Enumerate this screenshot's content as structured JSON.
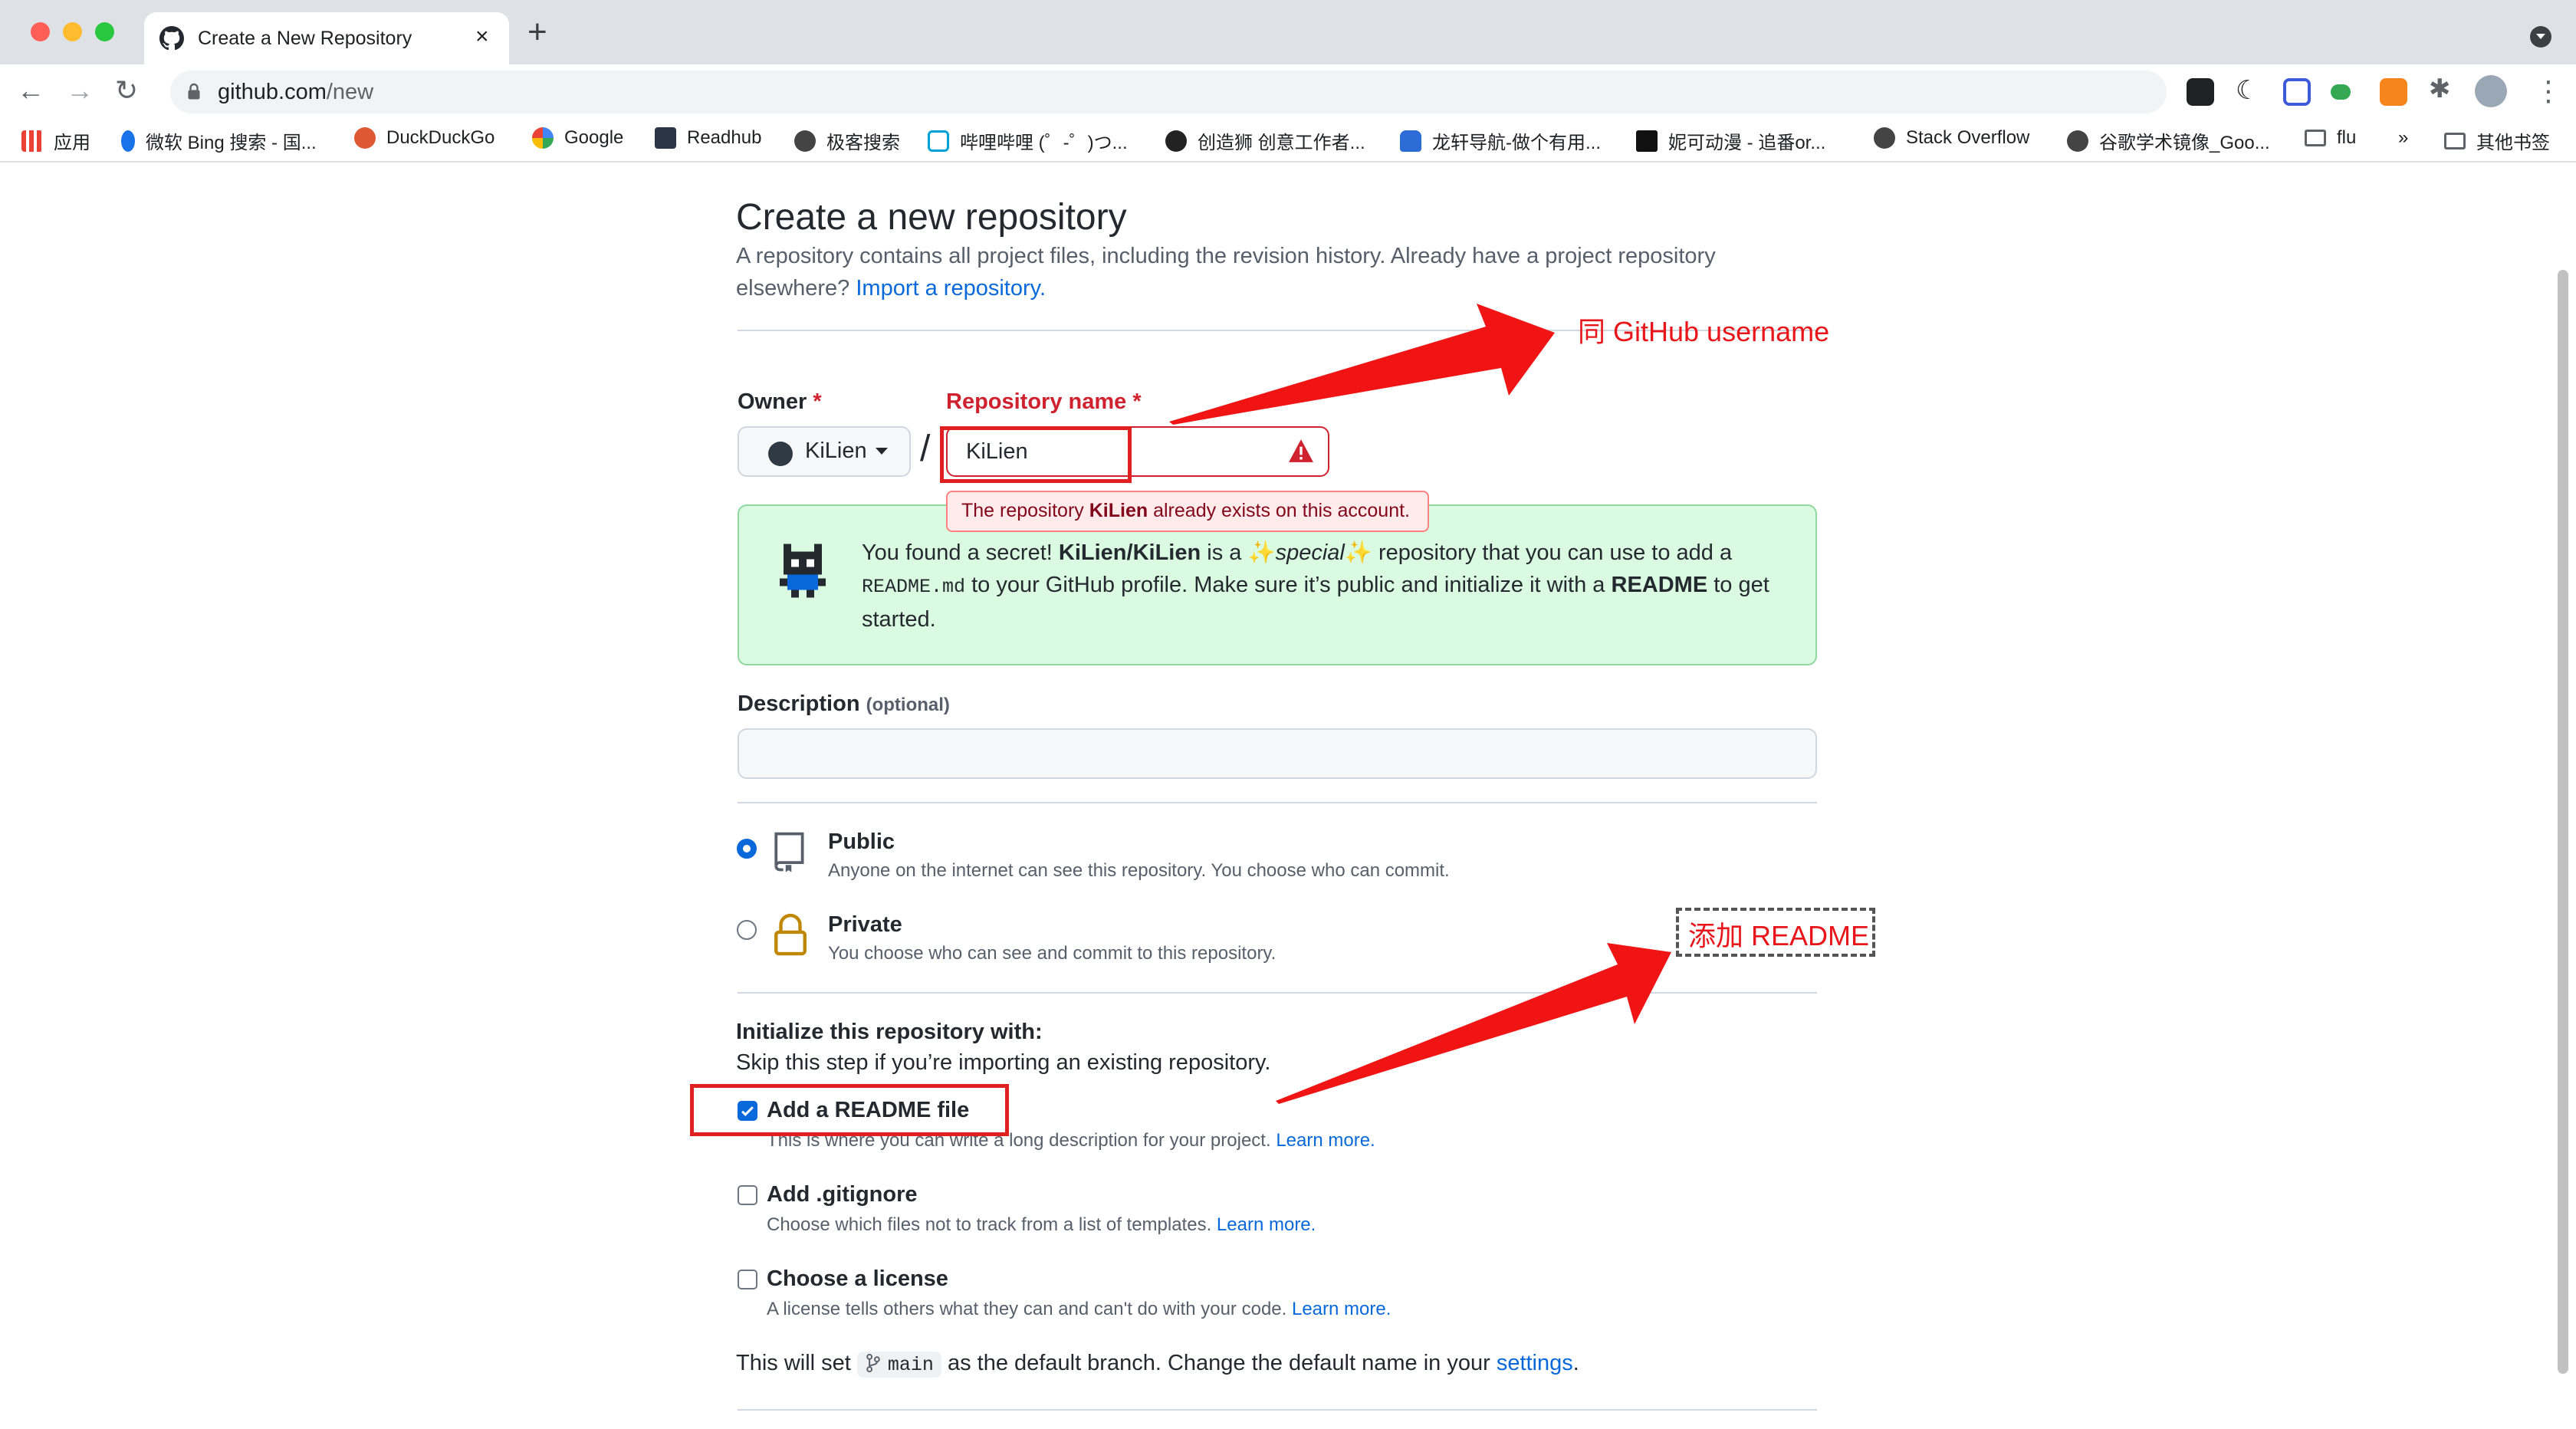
{
  "browser": {
    "tab_title": "Create a New Repository",
    "tab_close": "×",
    "new_tab": "+",
    "url_host": "github.com",
    "url_path": "/new",
    "bookmarks": [
      {
        "label": "应用",
        "color": "#4285f4"
      },
      {
        "label": "微软 Bing 搜索 - 国...",
        "color": "#1a73e8"
      },
      {
        "label": "DuckDuckGo",
        "color": "#de5833"
      },
      {
        "label": "Google",
        "color": "#4285f4"
      },
      {
        "label": "Readhub",
        "color": "#2b3445"
      },
      {
        "label": "极客搜索",
        "color": "#444444"
      },
      {
        "label": "哔哩哔哩 (゜-゜)つ...",
        "color": "#00a1d6"
      },
      {
        "label": "创造狮 创意工作者...",
        "color": "#222222"
      },
      {
        "label": "龙轩导航-做个有用...",
        "color": "#2d6bd6"
      },
      {
        "label": "妮可动漫 - 追番or...",
        "color": "#111111"
      },
      {
        "label": "Stack Overflow",
        "color": "#444444"
      },
      {
        "label": "谷歌学术镜像_Goo...",
        "color": "#444444"
      },
      {
        "label": "flu",
        "color": "#5f6368"
      },
      {
        "label": "»",
        "color": "#5f6368"
      },
      {
        "label": "其他书签",
        "color": "#5f6368"
      }
    ]
  },
  "page": {
    "title": "Create a new repository",
    "intro_line1": "A repository contains all project files, including the revision history. Already have a project repository",
    "intro_line2_prefix": "elsewhere? ",
    "import_link": "Import a repository.",
    "owner_label": "Owner",
    "required_mark": "*",
    "repo_label": "Repository name",
    "owner_value": "KiLien",
    "slash": "/",
    "repo_value": "KiLien",
    "error_prefix": "The repository ",
    "error_name": "KiLien",
    "error_suffix": " already exists on this account.",
    "secret_part1": "You found a secret! ",
    "secret_repo": "KiLien/KiLien",
    "secret_part2": " is a ✨",
    "secret_special": "special",
    "secret_part3": "✨ repository that you can use to add a ",
    "secret_code": "README.md",
    "secret_part4": " to your GitHub profile. Make sure it’s public and initialize it with a ",
    "secret_readme": "README",
    "secret_part5": " to get started.",
    "description_label": "Description",
    "description_optional": "(optional)",
    "public_title": "Public",
    "public_desc": "Anyone on the internet can see this repository. You choose who can commit.",
    "private_title": "Private",
    "private_desc": "You choose who can see and commit to this repository.",
    "init_title": "Initialize this repository with:",
    "init_sub": "Skip this step if you’re importing an existing repository.",
    "readme_title": "Add a README file",
    "readme_desc": "This is where you can write a long description for your project. ",
    "gitignore_title": "Add .gitignore",
    "gitignore_desc": "Choose which files not to track from a list of templates. ",
    "license_title": "Choose a license",
    "license_desc": "A license tells others what they can and can't do with your code. ",
    "learn_more": "Learn more.",
    "branch_prefix": "This will set ",
    "branch_name": "main",
    "branch_suffix": " as the default branch. Change the default name in your ",
    "settings_link": "settings",
    "branch_end": "."
  },
  "annotations": {
    "username_note": "同 GitHub username",
    "readme_note": "添加 README",
    "color": "#e8161b"
  }
}
